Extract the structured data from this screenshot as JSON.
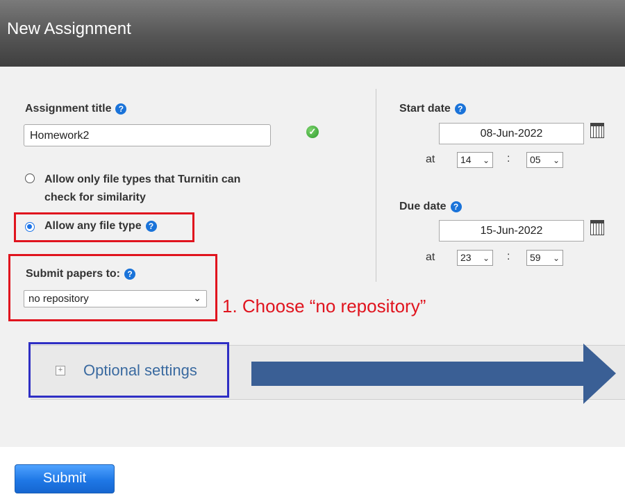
{
  "header": {
    "title": "New Assignment"
  },
  "assignment_title": {
    "label": "Assignment title",
    "help": "?",
    "value": "Homework2",
    "status_icon": "checkmark-icon"
  },
  "file_types": {
    "option_turnitin_line1": "Allow only file types that Turnitin can",
    "option_turnitin_line2": "check for similarity",
    "option_any": "Allow any file type",
    "selected": "Allow any file type",
    "help": "?"
  },
  "repository": {
    "label": "Submit papers to:",
    "help": "?",
    "value": "no repository"
  },
  "annotation": {
    "text": "1. Choose “no repository”",
    "color": "#e0141e"
  },
  "start_date": {
    "label": "Start date",
    "help": "?",
    "date": "08-Jun-2022",
    "at": "at",
    "hour": "14",
    "sep": ":",
    "minute": "05"
  },
  "due_date": {
    "label": "Due date",
    "help": "?",
    "date": "15-Jun-2022",
    "at": "at",
    "hour": "23",
    "sep": ":",
    "minute": "59"
  },
  "optional": {
    "label": "Optional settings",
    "expand_icon": "plus-icon"
  },
  "arrow": {
    "color": "#3a5f95"
  },
  "submit": {
    "label": "Submit"
  }
}
